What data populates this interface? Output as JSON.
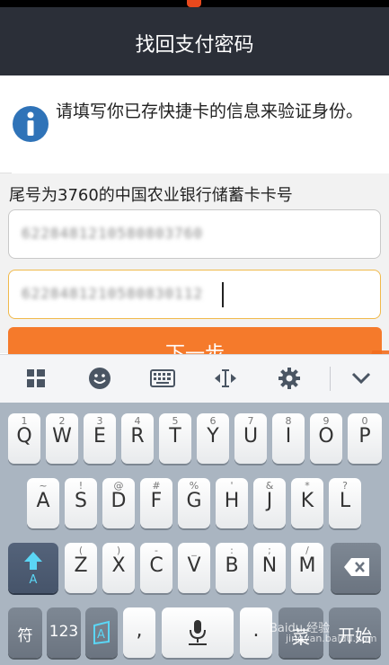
{
  "header": {
    "title": "找回支付密码"
  },
  "info": {
    "message": "请填写你已存快捷卡的信息来验证身份。"
  },
  "form": {
    "card_label": "尾号为3760的中国农业银行储蓄卡卡号",
    "field1_value": "6228481210580803760",
    "field2_value": "6228481210580830112",
    "next_label": "下一步"
  },
  "keyboard": {
    "toolbar": [
      "grid-icon",
      "emoji-icon",
      "keyboard-icon",
      "cursor-move-icon",
      "settings-icon",
      "collapse-icon"
    ],
    "row1": [
      {
        "sup": "1",
        "key": "Q"
      },
      {
        "sup": "2",
        "key": "W"
      },
      {
        "sup": "3",
        "key": "E"
      },
      {
        "sup": "4",
        "key": "R"
      },
      {
        "sup": "5",
        "key": "T"
      },
      {
        "sup": "6",
        "key": "Y"
      },
      {
        "sup": "7",
        "key": "U"
      },
      {
        "sup": "8",
        "key": "I"
      },
      {
        "sup": "9",
        "key": "O"
      },
      {
        "sup": "0",
        "key": "P"
      }
    ],
    "row2": [
      {
        "sup": "~",
        "key": "A"
      },
      {
        "sup": "!",
        "key": "S"
      },
      {
        "sup": "@",
        "key": "D"
      },
      {
        "sup": "#",
        "key": "F"
      },
      {
        "sup": "%",
        "key": "G"
      },
      {
        "sup": "'",
        "key": "H"
      },
      {
        "sup": "&",
        "key": "J"
      },
      {
        "sup": "*",
        "key": "K"
      },
      {
        "sup": "?",
        "key": "L"
      }
    ],
    "row3": [
      {
        "sup": "(",
        "key": "Z"
      },
      {
        "sup": ")",
        "key": "X"
      },
      {
        "sup": "-",
        "key": "C"
      },
      {
        "sup": "_",
        "key": "V"
      },
      {
        "sup": ":",
        "key": "B"
      },
      {
        "sup": ";",
        "key": "N"
      },
      {
        "sup": "/",
        "key": "M"
      }
    ],
    "shift_label": "A",
    "symbols_label": "符",
    "numbers_label": "123",
    "comma_label": ",",
    "period_label": ".",
    "cn_label": "菜",
    "enter_label": "开始"
  },
  "watermark": {
    "line1": "Baidu 经验",
    "line2": "jingyan.baidu.com"
  }
}
